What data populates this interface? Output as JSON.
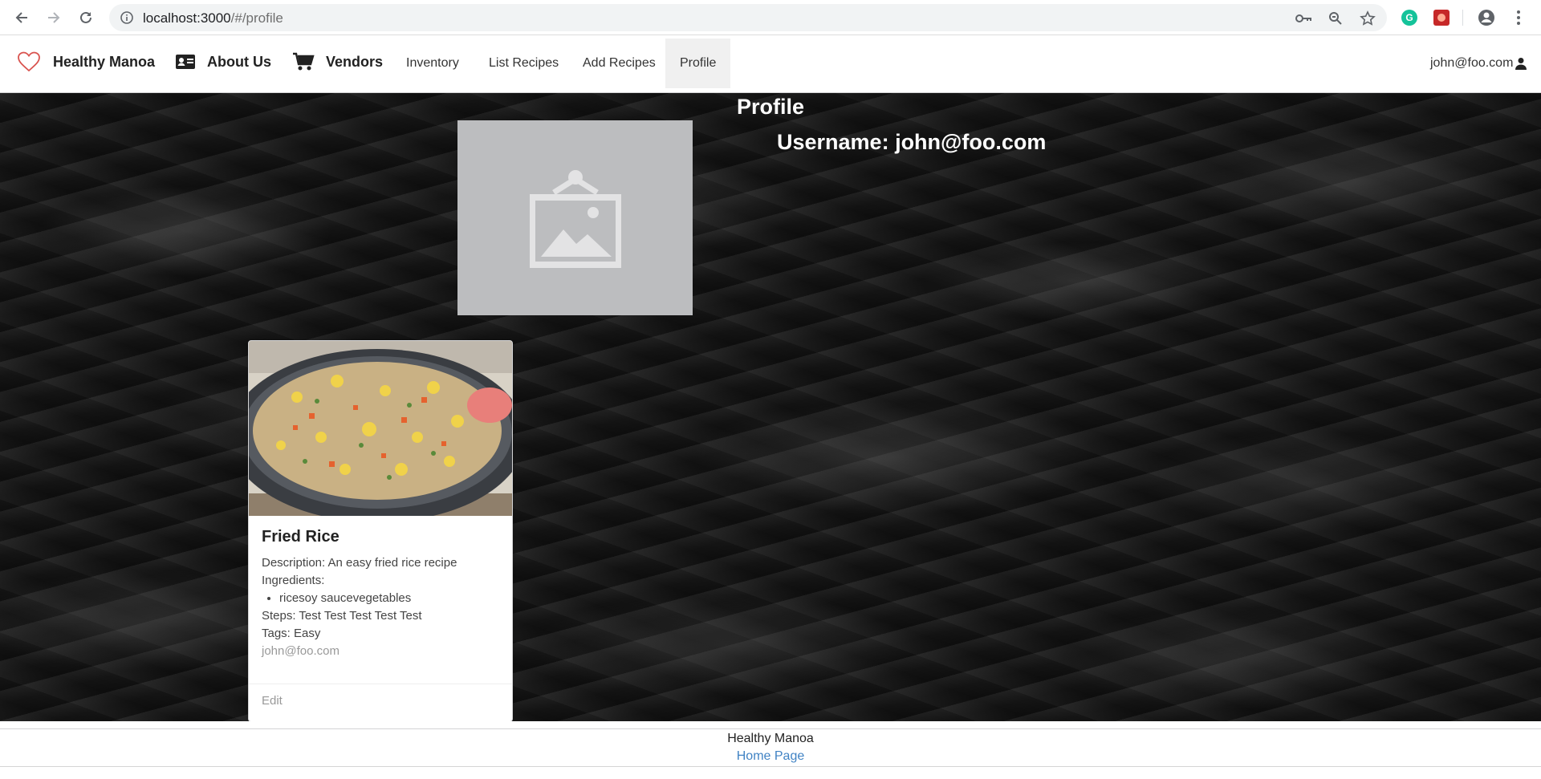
{
  "browser": {
    "url_host": "localhost:3000",
    "url_path": "/#/profile"
  },
  "navbar": {
    "brand": "Healthy Manoa",
    "about": "About Us",
    "vendors": "Vendors",
    "items": [
      "Inventory",
      "List Recipes",
      "Add Recipes",
      "Profile"
    ],
    "active_item": "Profile",
    "user": "john@foo.com"
  },
  "profile": {
    "title": "Profile",
    "username_label": "Username: john@foo.com"
  },
  "recipe_card": {
    "title": "Fried Rice",
    "description": "Description: An easy fried rice recipe",
    "ingredients_label": "Ingredients:",
    "ingredients": [
      "ricesoy saucevegetables"
    ],
    "steps": "Steps: Test Test Test Test Test",
    "tags": "Tags: Easy",
    "owner": "john@foo.com",
    "edit_link": "Edit"
  },
  "footer": {
    "site": "Healthy Manoa",
    "home_link": "Home Page"
  },
  "colors": {
    "accent_heart": "#d9534f",
    "link": "#4183c4",
    "active_tab_bg": "#f0f0f0",
    "placeholder_bg": "#bcbdbf"
  }
}
